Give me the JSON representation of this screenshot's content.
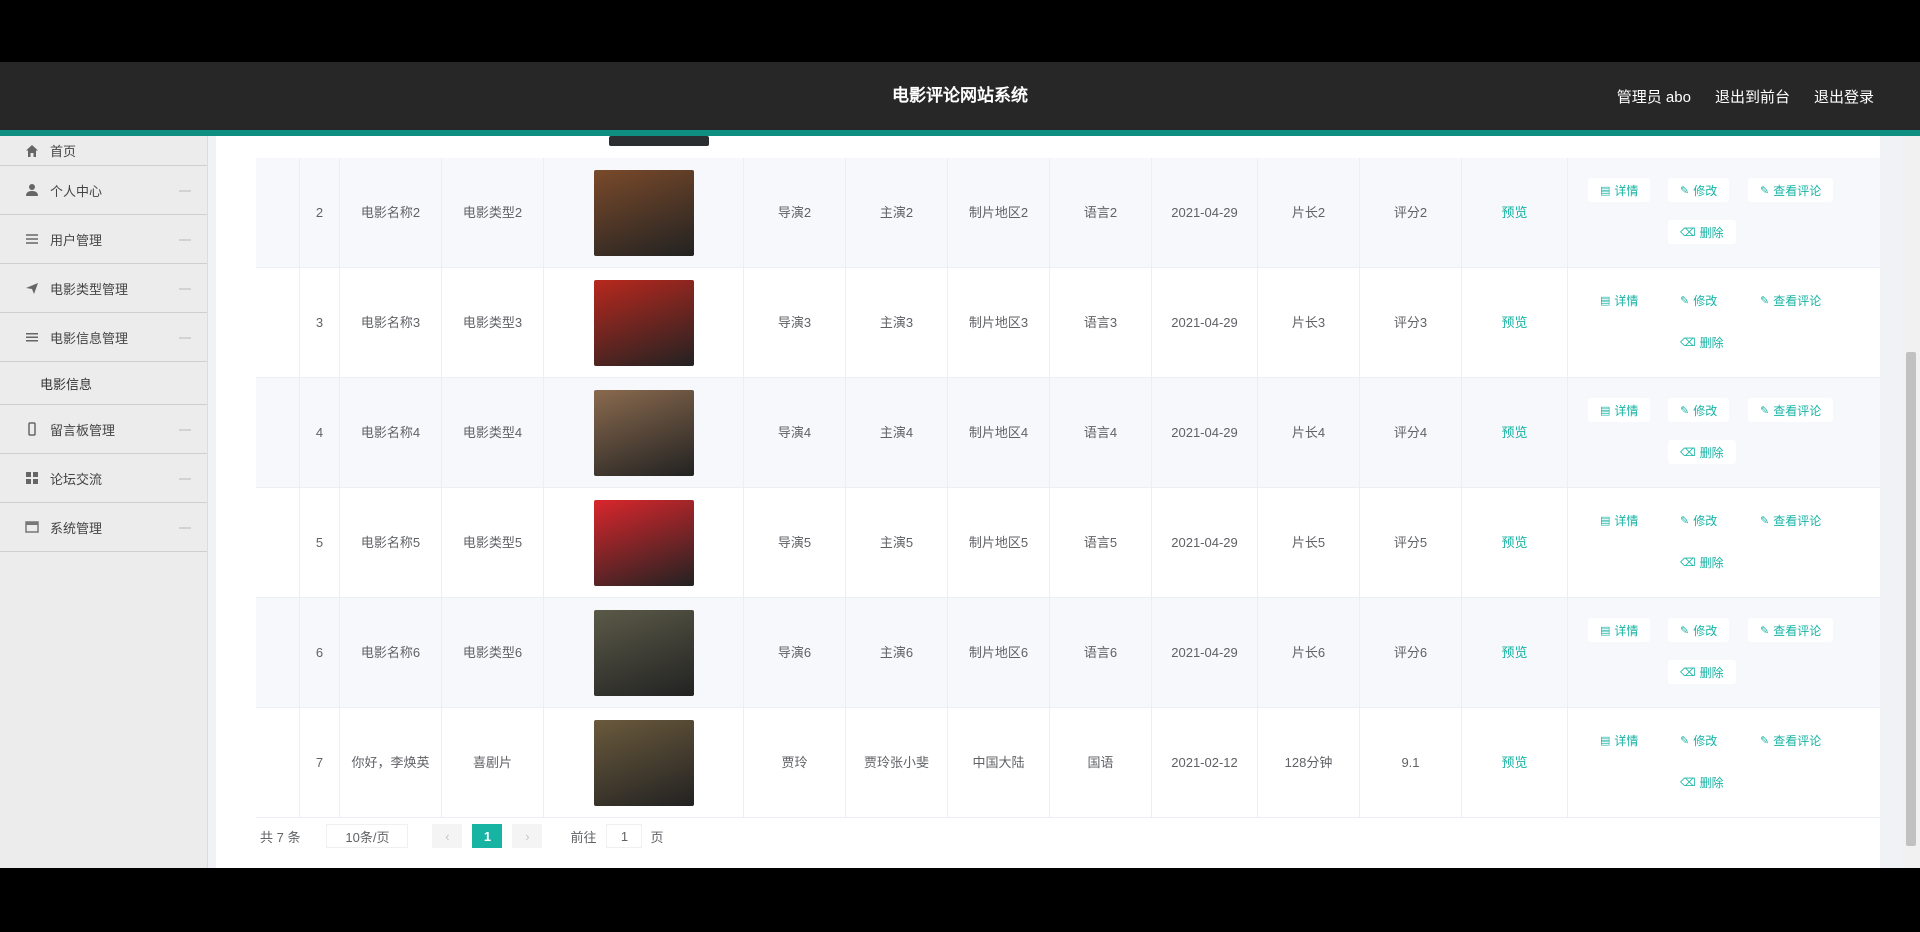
{
  "header": {
    "title": "电影评论网站系统",
    "admin": "管理员 abo",
    "to_front": "退出到前台",
    "logout": "退出登录"
  },
  "sidebar": {
    "items": [
      {
        "label": "首页",
        "icon": "home-icon"
      },
      {
        "label": "个人中心",
        "icon": "user-icon"
      },
      {
        "label": "用户管理",
        "icon": "grid-icon"
      },
      {
        "label": "电影类型管理",
        "icon": "send-icon"
      },
      {
        "label": "电影信息管理",
        "icon": "list-icon"
      },
      {
        "label": "留言板管理",
        "icon": "phone-icon"
      },
      {
        "label": "论坛交流",
        "icon": "apps-icon"
      },
      {
        "label": "系统管理",
        "icon": "window-icon"
      }
    ],
    "sub_item": "电影信息"
  },
  "table": {
    "rows": [
      {
        "no": "2",
        "name": "电影名称2",
        "type": "电影类型2",
        "director": "导演2",
        "actor": "主演2",
        "region": "制片地区2",
        "language": "语言2",
        "date": "2021-04-29",
        "length": "片长2",
        "score": "评分2",
        "preview": "预览",
        "poster_color": "#7a4a2a"
      },
      {
        "no": "3",
        "name": "电影名称3",
        "type": "电影类型3",
        "director": "导演3",
        "actor": "主演3",
        "region": "制片地区3",
        "language": "语言3",
        "date": "2021-04-29",
        "length": "片长3",
        "score": "评分3",
        "preview": "预览",
        "poster_color": "#b8281e"
      },
      {
        "no": "4",
        "name": "电影名称4",
        "type": "电影类型4",
        "director": "导演4",
        "actor": "主演4",
        "region": "制片地区4",
        "language": "语言4",
        "date": "2021-04-29",
        "length": "片长4",
        "score": "评分4",
        "preview": "预览",
        "poster_color": "#8a6a4e"
      },
      {
        "no": "5",
        "name": "电影名称5",
        "type": "电影类型5",
        "director": "导演5",
        "actor": "主演5",
        "region": "制片地区5",
        "language": "语言5",
        "date": "2021-04-29",
        "length": "片长5",
        "score": "评分5",
        "preview": "预览",
        "poster_color": "#d9262c"
      },
      {
        "no": "6",
        "name": "电影名称6",
        "type": "电影类型6",
        "director": "导演6",
        "actor": "主演6",
        "region": "制片地区6",
        "language": "语言6",
        "date": "2021-04-29",
        "length": "片长6",
        "score": "评分6",
        "preview": "预览",
        "poster_color": "#5b5a48"
      },
      {
        "no": "7",
        "name": "你好，李焕英",
        "type": "喜剧片",
        "director": "贾玲",
        "actor": "贾玲张小斐",
        "region": "中国大陆",
        "language": "国语",
        "date": "2021-02-12",
        "length": "128分钟",
        "score": "9.1",
        "preview": "预览",
        "poster_color": "#6b5a3c"
      }
    ],
    "ops": {
      "detail": "详情",
      "edit": "修改",
      "comments": "查看评论",
      "delete": "删除"
    }
  },
  "pager": {
    "total": "共 7 条",
    "size": "10条/页",
    "current": "1",
    "goto_prefix": "前往",
    "goto_value": "1",
    "goto_suffix": "页"
  }
}
